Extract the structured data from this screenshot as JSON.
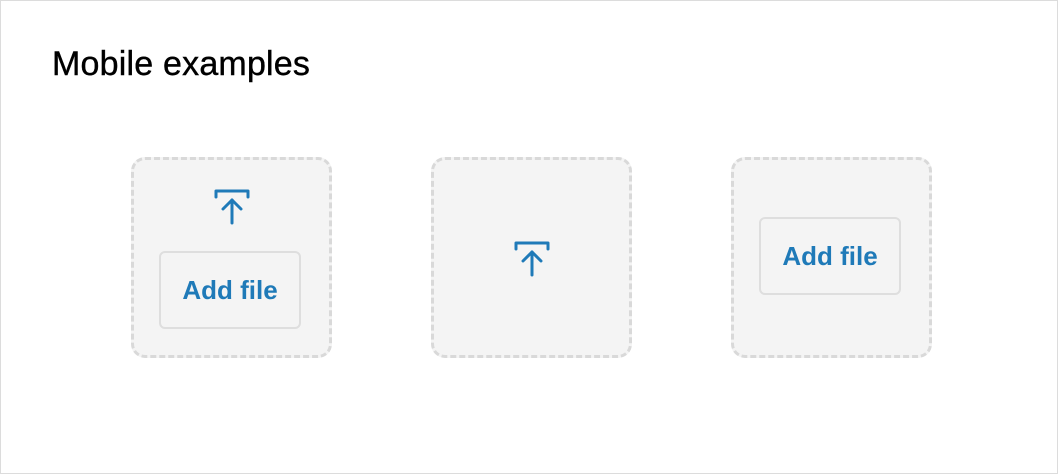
{
  "page": {
    "title": "Mobile examples"
  },
  "examples": [
    {
      "icon": "upload-icon",
      "button_label": "Add file"
    },
    {
      "icon": "upload-icon"
    },
    {
      "button_label": "Add file"
    }
  ],
  "colors": {
    "accent": "#1f7ab8",
    "dropzone_bg": "#f4f4f4",
    "dropzone_border": "#d9d9d9",
    "button_border": "#dedede"
  }
}
